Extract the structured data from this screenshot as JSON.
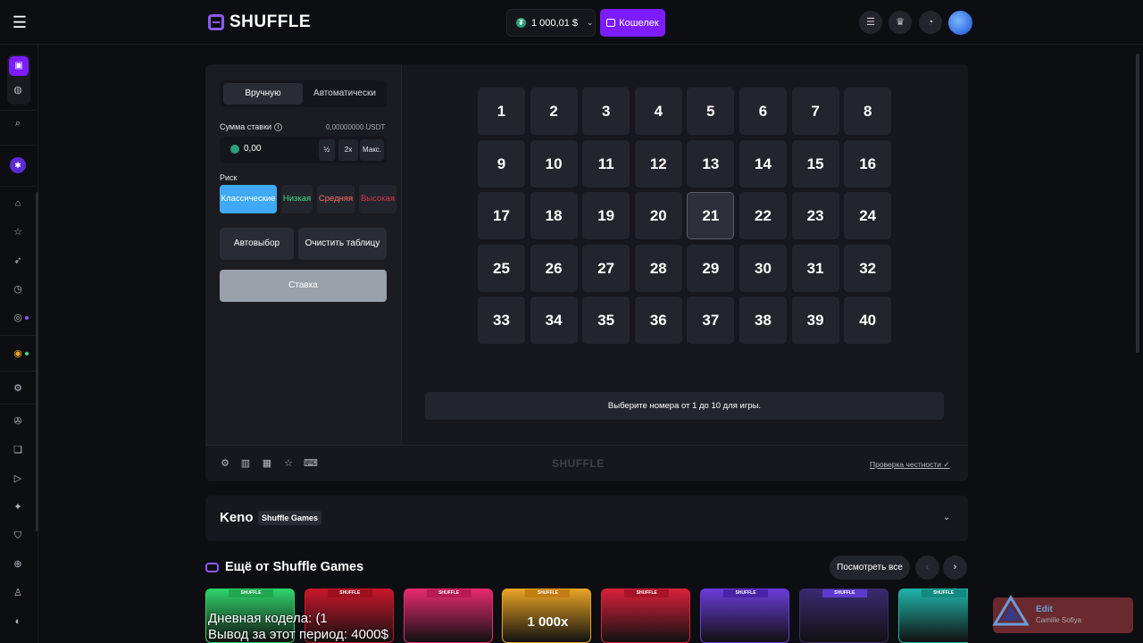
{
  "header": {
    "logo_text": "SHUFFLE",
    "balance": "1 000,01 $",
    "wallet_label": "Кошелек"
  },
  "controls": {
    "tabs": [
      "Вручную",
      "Автоматически"
    ],
    "bet_label": "Сумма ставки",
    "bet_currency_amount": "0,00000000 USDT",
    "bet_value": "0,00",
    "half_label": "½",
    "double_label": "2x",
    "max_label": "Макс.",
    "risk_label": "Риск",
    "risk_options": [
      {
        "label": "Классические",
        "color": "#ffffff"
      },
      {
        "label": "Низкая",
        "color": "#3ddc84"
      },
      {
        "label": "Средняя",
        "color": "#ff6b6b"
      },
      {
        "label": "Высокая",
        "color": "#d8334a"
      }
    ],
    "auto_pick_label": "Автовыбор",
    "clear_label": "Очистить таблицу",
    "bet_button_label": "Ставка"
  },
  "board": {
    "numbers": [
      "1",
      "2",
      "3",
      "4",
      "5",
      "6",
      "7",
      "8",
      "9",
      "10",
      "11",
      "12",
      "13",
      "14",
      "15",
      "16",
      "17",
      "18",
      "19",
      "20",
      "21",
      "22",
      "23",
      "24",
      "25",
      "26",
      "27",
      "28",
      "29",
      "30",
      "31",
      "32",
      "33",
      "34",
      "35",
      "36",
      "37",
      "38",
      "39",
      "40"
    ],
    "hovered": "21",
    "hint": "Выберите номера от 1 до 10 для игры."
  },
  "footer": {
    "logo_text": "SHUFFLE",
    "fairness_label": "Проверка честности"
  },
  "info": {
    "title": "Keno",
    "badge": "Shuffle Games"
  },
  "more": {
    "title": "Ещё от Shuffle Games",
    "see_all_label": "Посмотреть все",
    "thumbs": [
      {
        "tag": "SHUFFLE",
        "text": "",
        "bg": "#2fd36b",
        "tag_bg": "#1fa84f"
      },
      {
        "tag": "SHUFFLE",
        "text": "",
        "bg": "#c8162b",
        "tag_bg": "#9e0f20"
      },
      {
        "tag": "SHUFFLE",
        "text": "",
        "bg": "#e62a6e",
        "tag_bg": "#b81a52"
      },
      {
        "tag": "SHUFFLE",
        "text": "1 000x",
        "bg": "#e8a325",
        "tag_bg": "#c27d12"
      },
      {
        "tag": "SHUFFLE",
        "text": "",
        "bg": "#d8203a",
        "tag_bg": "#a81328"
      },
      {
        "tag": "SHUFFLE",
        "text": "",
        "bg": "#6a3bd8",
        "tag_bg": "#4a22a8"
      },
      {
        "tag": "SHUFFLE",
        "text": "",
        "bg": "#3a2a70",
        "tag_bg": "#5e3ad0"
      },
      {
        "tag": "SHUFFLE",
        "text": "",
        "bg": "#1fb3a8",
        "tag_bg": "#138a80"
      }
    ]
  },
  "overlay": {
    "line1": "Дневная кодела: (1",
    "line2": "Вывод за этот период: 4000$"
  },
  "toast": {
    "title": "Edit",
    "subtitle": "Camille Sofiya"
  }
}
